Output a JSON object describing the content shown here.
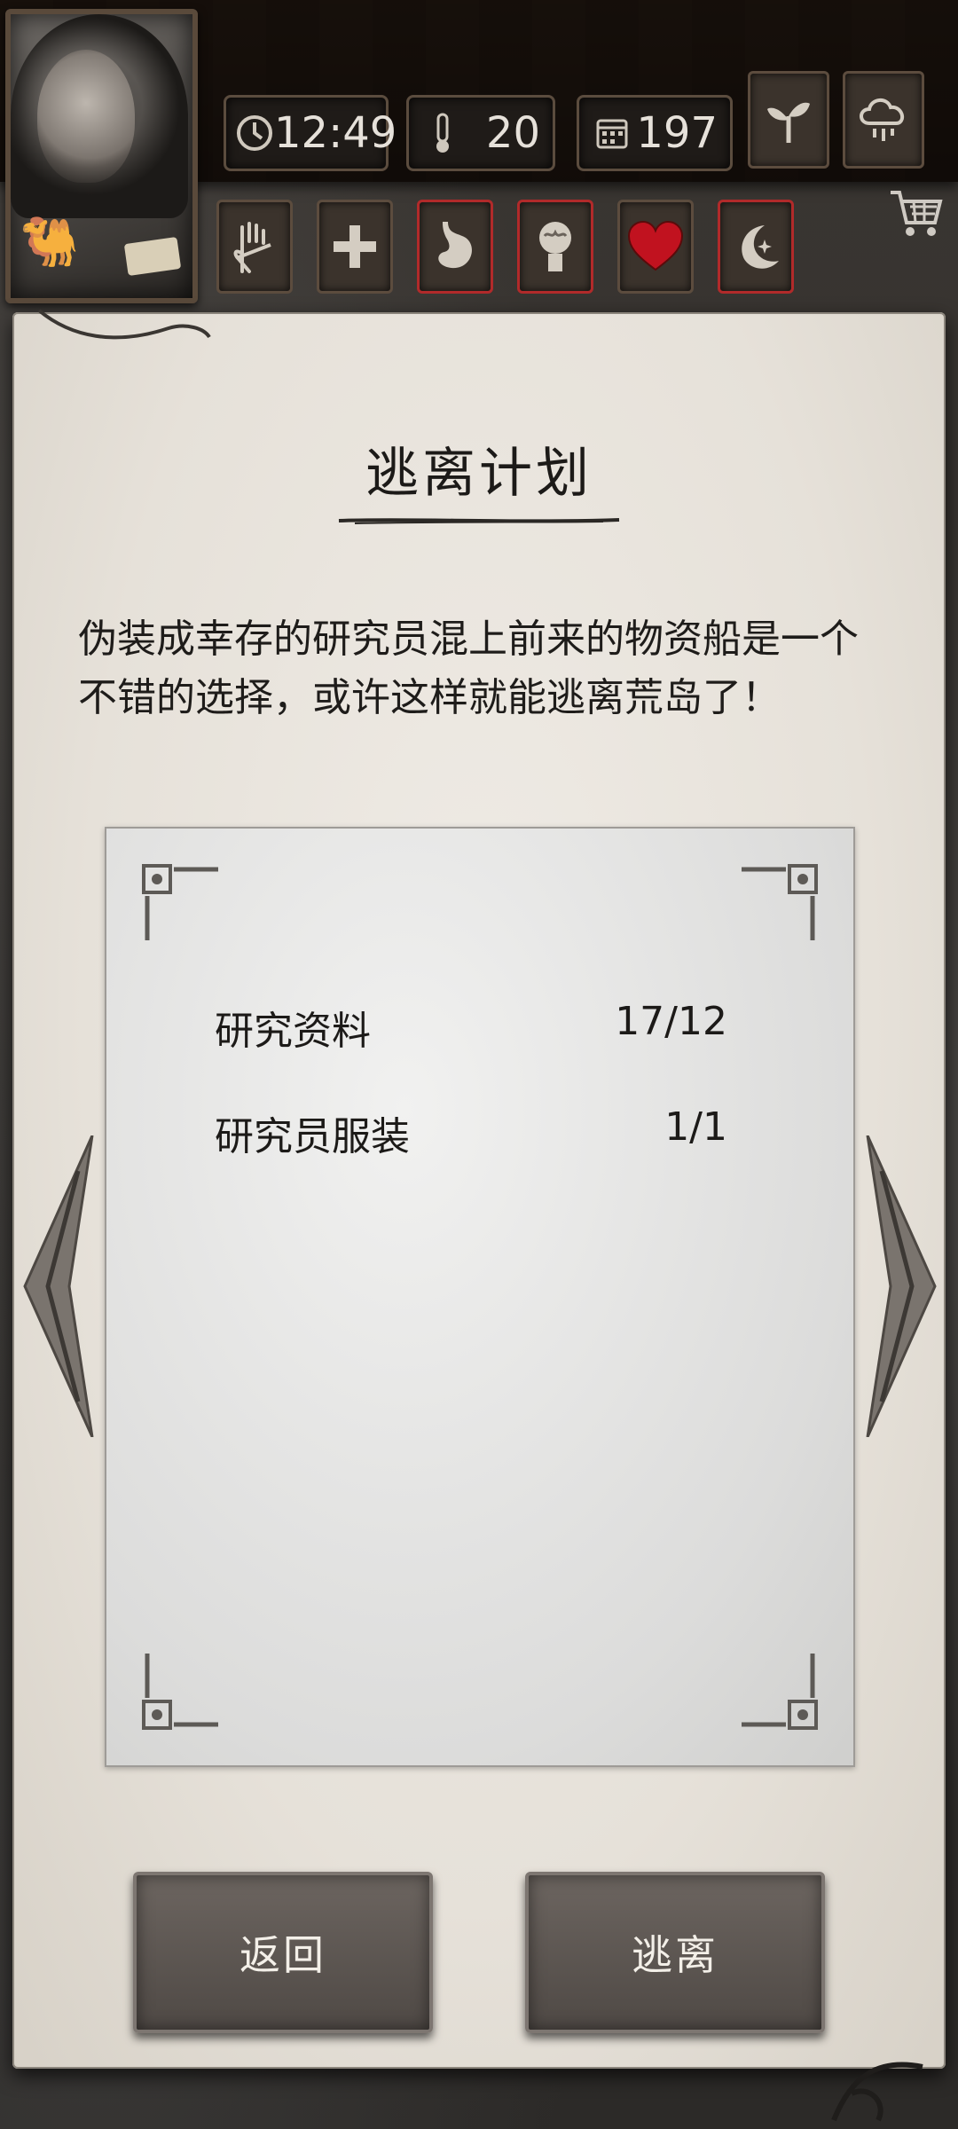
{
  "hud": {
    "time": "12:49",
    "temperature": "20",
    "day": "197"
  },
  "plan": {
    "title": "逃离计划",
    "description_line1": "伪装成幸存的研究员混上前来的物资船是一个",
    "description_line2": "不错的选择，或许这样就能逃离荒岛了！",
    "requirements": [
      {
        "name": "研究资料",
        "value": "17/12"
      },
      {
        "name": "研究员服装",
        "value": "1/1"
      }
    ]
  },
  "buttons": {
    "back": "返回",
    "escape": "逃离"
  },
  "colors": {
    "status_red": "#b12a2a",
    "heart": "#c1121f",
    "paper": "#e6e1d9"
  }
}
